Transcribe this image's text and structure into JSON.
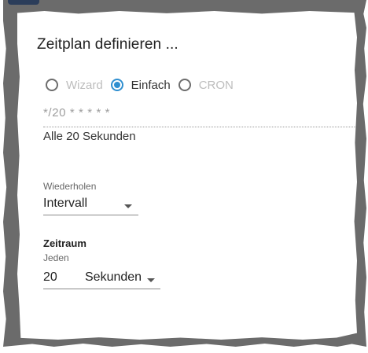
{
  "dialog": {
    "title": "Zeitplan definieren ..."
  },
  "mode": {
    "options": [
      {
        "label": "Wizard",
        "checked": false,
        "enabled": false
      },
      {
        "label": "Einfach",
        "checked": true,
        "enabled": true
      },
      {
        "label": "CRON",
        "checked": false,
        "enabled": false
      }
    ]
  },
  "cron": {
    "expression": "*/20 * * * * *",
    "description": "Alle 20 Sekunden"
  },
  "repeat": {
    "caption": "Wiederholen",
    "value": "Intervall"
  },
  "period": {
    "title": "Zeitraum",
    "caption": "Jeden",
    "amount": "20",
    "unit": "Sekunden"
  },
  "colors": {
    "accent": "#2f8fd0",
    "backdrop": "#6b6b6b",
    "disabled_text": "#bdbdbd"
  },
  "icons": {
    "checked_radio": "radio-checked-icon",
    "unchecked_radio": "radio-unchecked-icon",
    "dropdown": "caret-down-icon"
  }
}
